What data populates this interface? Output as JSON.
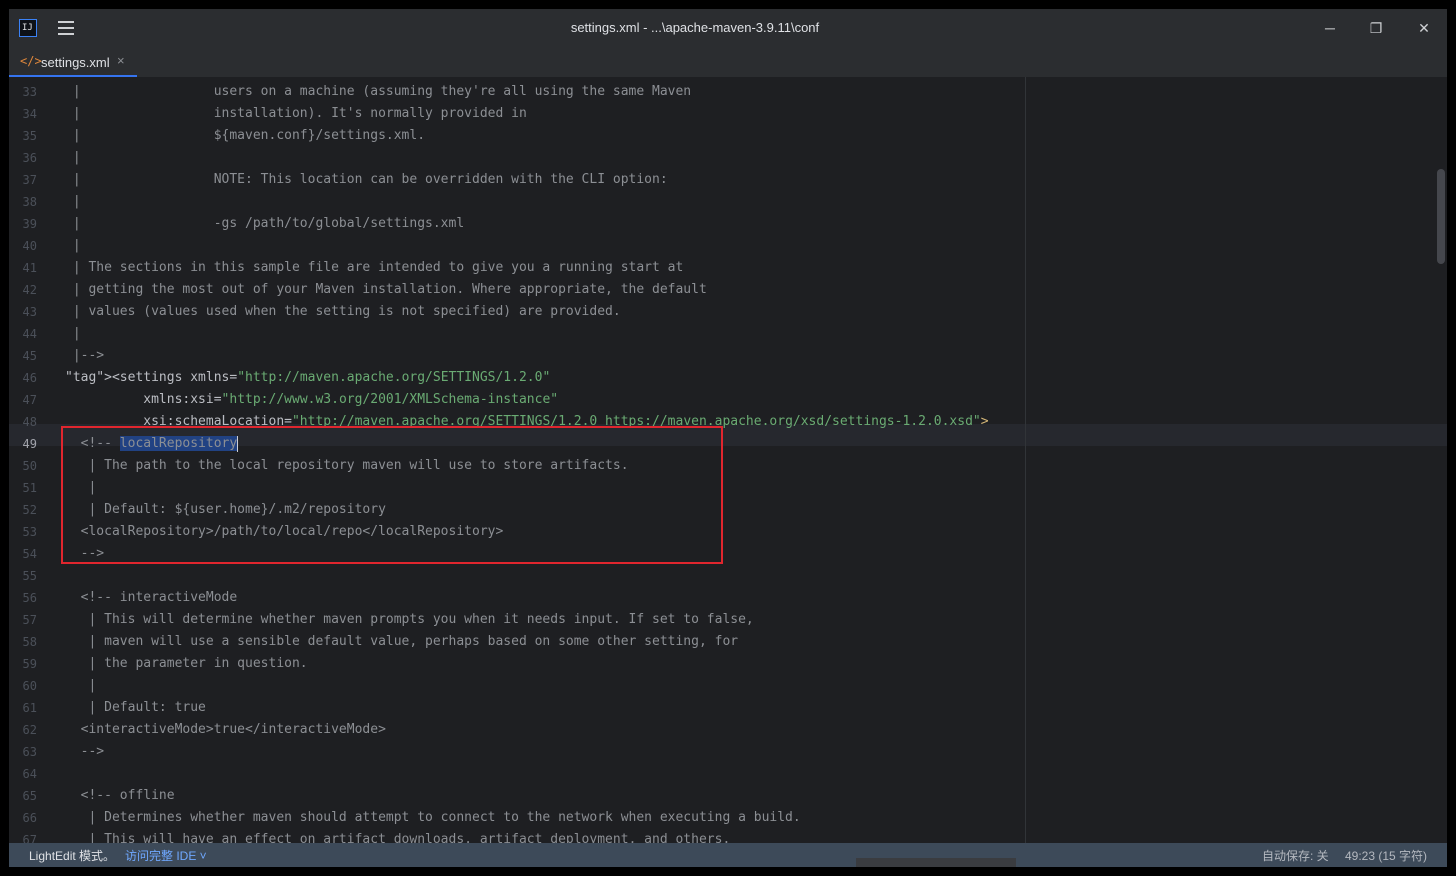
{
  "window": {
    "title": "settings.xml - ...\\apache-maven-3.9.11\\conf",
    "app_icon_text": "IJ",
    "buttons": {
      "minimize": "─",
      "restore": "❐",
      "close": "✕"
    }
  },
  "tabs": [
    {
      "label": "settings.xml",
      "icon": "</>",
      "close": "×"
    }
  ],
  "editor": {
    "current_line": 49,
    "lines": [
      {
        "n": 33,
        "text": " |                 users on a machine (assuming they're all using the same Maven"
      },
      {
        "n": 34,
        "text": " |                 installation). It's normally provided in"
      },
      {
        "n": 35,
        "text": " |                 ${maven.conf}/settings.xml."
      },
      {
        "n": 36,
        "text": " |"
      },
      {
        "n": 37,
        "text": " |                 NOTE: This location can be overridden with the CLI option:"
      },
      {
        "n": 38,
        "text": " |"
      },
      {
        "n": 39,
        "text": " |                 -gs /path/to/global/settings.xml"
      },
      {
        "n": 40,
        "text": " |"
      },
      {
        "n": 41,
        "text": " | The sections in this sample file are intended to give you a running start at"
      },
      {
        "n": 42,
        "text": " | getting the most out of your Maven installation. Where appropriate, the default"
      },
      {
        "n": 43,
        "text": " | values (values used when the setting is not specified) are provided."
      },
      {
        "n": 44,
        "text": " |"
      },
      {
        "n": 45,
        "text": " |-->"
      },
      {
        "n": 46,
        "text": "<settings xmlns=\"http://maven.apache.org/SETTINGS/1.2.0\""
      },
      {
        "n": 47,
        "text": "          xmlns:xsi=\"http://www.w3.org/2001/XMLSchema-instance\""
      },
      {
        "n": 48,
        "text": "          xsi:schemaLocation=\"http://maven.apache.org/SETTINGS/1.2.0 https://maven.apache.org/xsd/settings-1.2.0.xsd\">"
      },
      {
        "n": 49,
        "text": "  <!-- localRepository"
      },
      {
        "n": 50,
        "text": "   | The path to the local repository maven will use to store artifacts."
      },
      {
        "n": 51,
        "text": "   |"
      },
      {
        "n": 52,
        "text": "   | Default: ${user.home}/.m2/repository"
      },
      {
        "n": 53,
        "text": "  <localRepository>/path/to/local/repo</localRepository>"
      },
      {
        "n": 54,
        "text": "  -->"
      },
      {
        "n": 55,
        "text": ""
      },
      {
        "n": 56,
        "text": "  <!-- interactiveMode"
      },
      {
        "n": 57,
        "text": "   | This will determine whether maven prompts you when it needs input. If set to false,"
      },
      {
        "n": 58,
        "text": "   | maven will use a sensible default value, perhaps based on some other setting, for"
      },
      {
        "n": 59,
        "text": "   | the parameter in question."
      },
      {
        "n": 60,
        "text": "   |"
      },
      {
        "n": 61,
        "text": "   | Default: true"
      },
      {
        "n": 62,
        "text": "  <interactiveMode>true</interactiveMode>"
      },
      {
        "n": 63,
        "text": "  -->"
      },
      {
        "n": 64,
        "text": ""
      },
      {
        "n": 65,
        "text": "  <!-- offline"
      },
      {
        "n": 66,
        "text": "   | Determines whether maven should attempt to connect to the network when executing a build."
      },
      {
        "n": 67,
        "text": "   | This will have an effect on artifact downloads, artifact deployment, and others."
      }
    ],
    "selected_text": "localRepository",
    "colors": {
      "tag": "#d5b778",
      "string": "#6aab73",
      "comment": "#8c8f94",
      "highlight_box": "#e0262e",
      "selection": "#214283"
    }
  },
  "statusbar": {
    "mode": "LightEdit 模式。",
    "access_ide": "访问完整 IDE ˅",
    "autosave": "自动保存: 关",
    "position": "49:23 (15 字符)"
  }
}
